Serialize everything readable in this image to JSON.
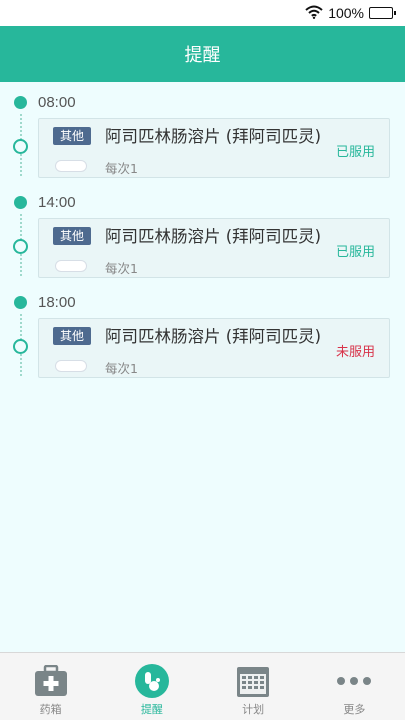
{
  "status_bar": {
    "battery_text": "100%"
  },
  "header": {
    "title": "提醒"
  },
  "reminders": [
    {
      "time": "08:00",
      "tag": "其他",
      "drug": "阿司匹林肠溶片 (拜阿司匹灵)",
      "dose": "每次1",
      "status": "已服用",
      "taken": true
    },
    {
      "time": "14:00",
      "tag": "其他",
      "drug": "阿司匹林肠溶片 (拜阿司匹灵)",
      "dose": "每次1",
      "status": "已服用",
      "taken": true
    },
    {
      "time": "18:00",
      "tag": "其他",
      "drug": "阿司匹林肠溶片 (拜阿司匹灵)",
      "dose": "每次1",
      "status": "未服用",
      "taken": false
    }
  ],
  "tabbar": {
    "items": [
      {
        "label": "药箱",
        "icon": "medicine-box-icon",
        "active": false
      },
      {
        "label": "提醒",
        "icon": "pill-reminder-icon",
        "active": true
      },
      {
        "label": "计划",
        "icon": "calendar-icon",
        "active": false
      },
      {
        "label": "更多",
        "icon": "more-dots-icon",
        "active": false
      }
    ]
  },
  "colors": {
    "accent": "#27b79b",
    "tag_bg": "#4e6a8f",
    "missed": "#d8334a",
    "background": "#eefdfe"
  }
}
